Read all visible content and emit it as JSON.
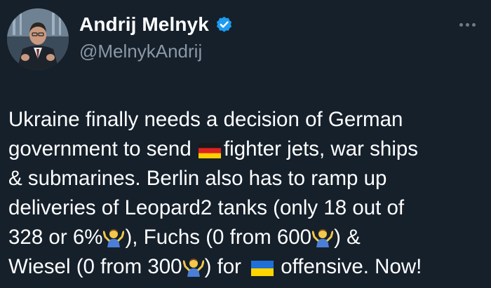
{
  "author": {
    "display_name": "Andrij Melnyk",
    "handle": "@MelnykAndrij",
    "verified": true
  },
  "tweet": {
    "line1": "Ukraine finally needs a decision of German",
    "line2_a": "government to send ",
    "line2_b": "fighter jets, war ships",
    "line3": "& submarines. Berlin also has to ramp up",
    "line4": "deliveries of Leopard2 tanks (only 18 out of",
    "line5_a": "328 or 6%",
    "line5_b": "), Fuchs (0 from 600",
    "line5_c": ") &",
    "line6_a": "Wiesel (0 from 300",
    "line6_b": ") for ",
    "line6_c": "offensive. Now!"
  },
  "icons": {
    "verified": "verified-badge-icon",
    "more": "more-options-icon",
    "flag_de": "germany-flag-emoji",
    "flag_ua": "ukraine-flag-emoji",
    "shrug": "person-shrugging-emoji"
  },
  "colors": {
    "background": "#15202b",
    "text": "#ffffff",
    "secondary_text": "#8b98a5",
    "verified_blue": "#1d9bf0"
  }
}
